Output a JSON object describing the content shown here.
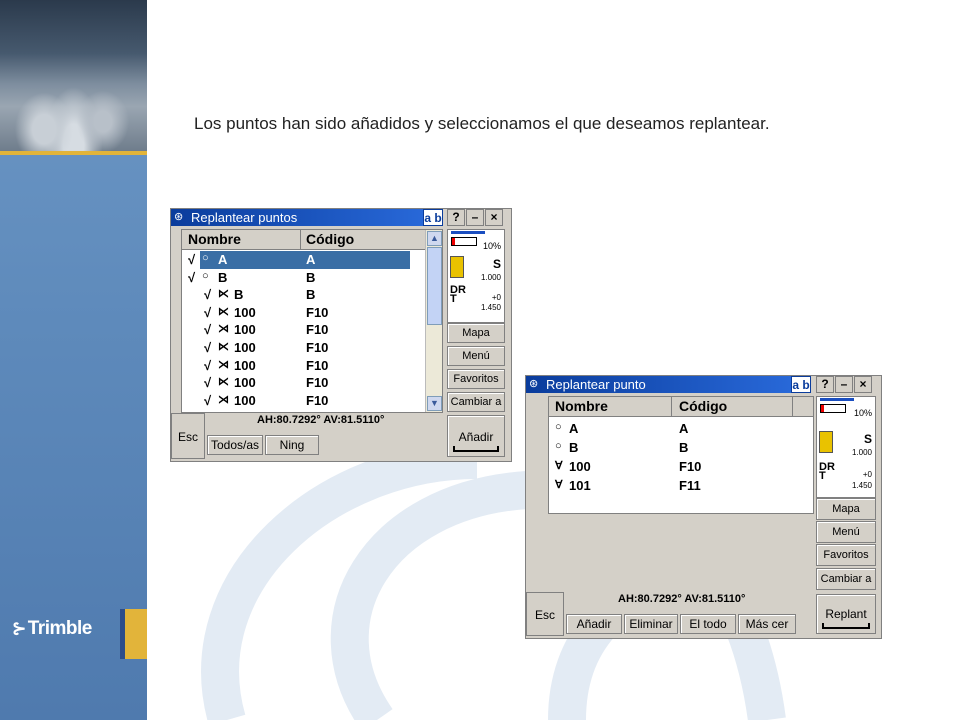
{
  "slide": {
    "caption": "Los puntos han sido añadidos y seleccionamos el que deseamos replantear.",
    "logo_text": "Trimble",
    "logo_mark": "⊱",
    "accent_gold": "#e2b43a",
    "sidebar_blue": "#5e8abb"
  },
  "window1": {
    "title": "Replantear puntos",
    "ab_label": "a b",
    "help_label": "?",
    "min_label": "–",
    "close_label": "×",
    "columns": [
      "Nombre",
      "Código"
    ],
    "rows": [
      {
        "check": "√",
        "symbol": "○",
        "name": "A",
        "code": "A",
        "selected": true
      },
      {
        "check": "√",
        "symbol": "○",
        "name": "B",
        "code": "B",
        "selected": false
      },
      {
        "check": "√",
        "symbol": "⋉",
        "name": "B",
        "code": "B",
        "selected": false
      },
      {
        "check": "√",
        "symbol": "⋉",
        "name": "100",
        "code": "F10",
        "selected": false
      },
      {
        "check": "√",
        "symbol": "⋊",
        "name": "100",
        "code": "F10",
        "selected": false
      },
      {
        "check": "√",
        "symbol": "⋉",
        "name": "100",
        "code": "F10",
        "selected": false
      },
      {
        "check": "√",
        "symbol": "⋊",
        "name": "100",
        "code": "F10",
        "selected": false
      },
      {
        "check": "√",
        "symbol": "⋉",
        "name": "100",
        "code": "F10",
        "selected": false
      },
      {
        "check": "√",
        "symbol": "⋊",
        "name": "100",
        "code": "F10",
        "selected": false
      }
    ],
    "scroll_up": "▲",
    "scroll_down": "▼",
    "status": {
      "battery": "10%",
      "s_label": "S",
      "s_value": "1.000",
      "dr_label": "DR",
      "t_label": "T",
      "offset": "+0",
      "height": "1.450"
    },
    "side_buttons": [
      "Mapa",
      "Menú",
      "Favoritos",
      "Cambiar a"
    ],
    "angles": "AH:80.7292°  AV:81.5110°",
    "esc_label": "Esc",
    "bottom_buttons": [
      "Todos/as",
      "Ning"
    ],
    "action_label": "Añadir"
  },
  "window2": {
    "title": "Replantear punto",
    "ab_label": "a b",
    "help_label": "?",
    "min_label": "–",
    "close_label": "×",
    "columns": [
      "Nombre",
      "Código"
    ],
    "rows": [
      {
        "symbol": "○",
        "name": "A",
        "code": "A"
      },
      {
        "symbol": "○",
        "name": "B",
        "code": "B"
      },
      {
        "symbol": "∀",
        "name": "100",
        "code": "F10"
      },
      {
        "symbol": "∀",
        "name": "101",
        "code": "F11"
      }
    ],
    "status": {
      "battery": "10%",
      "s_label": "S",
      "s_value": "1.000",
      "dr_label": "DR",
      "t_label": "T",
      "offset": "+0",
      "height": "1.450"
    },
    "side_buttons": [
      "Mapa",
      "Menú",
      "Favoritos",
      "Cambiar a"
    ],
    "angles": "AH:80.7292°  AV:81.5110°",
    "esc_label": "Esc",
    "bottom_buttons": [
      "Añadir",
      "Eliminar",
      "El todo",
      "Más cer"
    ],
    "action_label": "Replant"
  }
}
